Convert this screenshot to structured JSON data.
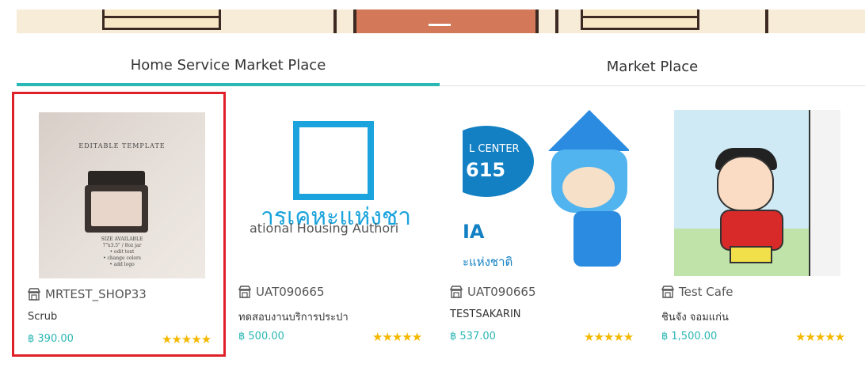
{
  "tabs": [
    {
      "label": "Home Service Market Place",
      "active": true
    },
    {
      "label": "Market Place",
      "active": false
    }
  ],
  "accent_color": "#2bb7b3",
  "selection_color": "#e02028",
  "products": [
    {
      "shop": "MRTEST_SHOP33",
      "name": "Scrub",
      "price": "฿ 390.00",
      "rating": 5,
      "stars": "★★★★★",
      "image": {
        "title": "EDITABLE TEMPLATE",
        "size_label": "SIZE AVAILABLE",
        "lines": [
          "7\"x3.5\" / 8oz jar",
          "• edit text",
          "• change colors",
          "• add logo"
        ]
      }
    },
    {
      "shop": "UAT090665",
      "name": "ทดสอบงานบริการประปา",
      "price": "฿ 500.00",
      "rating": 5,
      "stars": "★★★★★",
      "image": {
        "thai_text": "ารเคหะแห่งชา",
        "eng_text": "ational Housing Authori"
      }
    },
    {
      "shop": "UAT090665",
      "name": "TESTSAKARIN",
      "price": "฿ 537.00",
      "rating": 5,
      "stars": "★★★★★",
      "image": {
        "center_text": "L CENTER",
        "number_text": "615",
        "logo_text": "IA",
        "thai_text": "ะแห่งชาติ"
      }
    },
    {
      "shop": "Test Cafe",
      "name": "ชินจัง จอมแก่น",
      "price": "฿ 1,500.00",
      "rating": 5,
      "stars": "★★★★★"
    }
  ]
}
